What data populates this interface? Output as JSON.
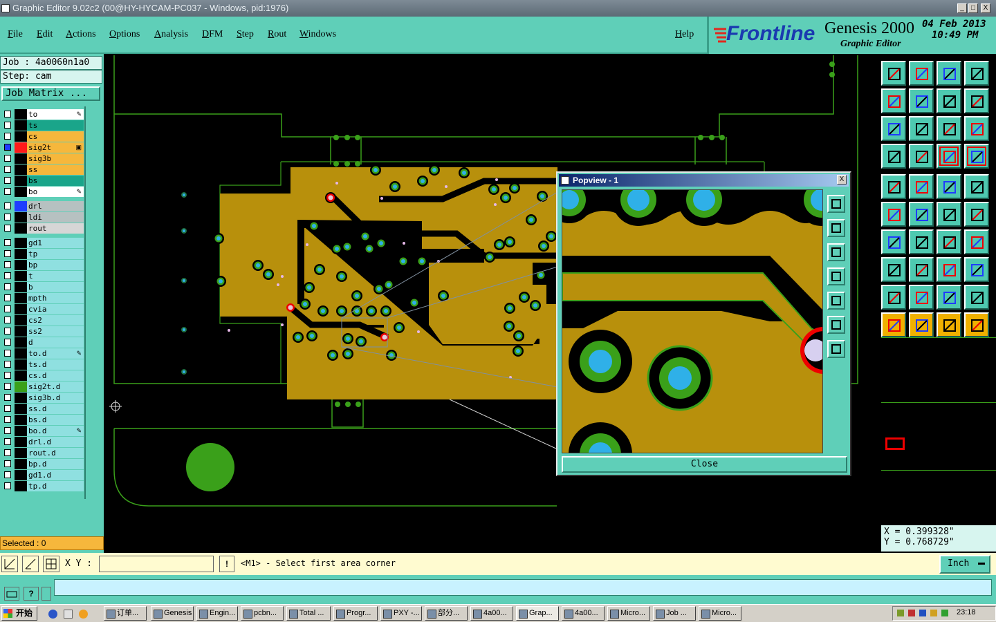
{
  "window": {
    "title": "Graphic Editor 9.02c2 (00@HY-HYCAM-PC037 - Windows, pid:1976)",
    "min": "_",
    "max": "□",
    "close": "X"
  },
  "menu": {
    "items": [
      "File",
      "Edit",
      "Actions",
      "Options",
      "Analysis",
      "DFM",
      "Step",
      "Rout",
      "Windows"
    ],
    "help": "Help"
  },
  "brand": {
    "logo": "Frontline",
    "product": "Genesis 2000",
    "subtitle": "Graphic Editor",
    "date": "04 Feb 2013",
    "time": "10:49 PM"
  },
  "job": {
    "job_label": "Job : 4a0060n1a0",
    "step_label": "Step: cam",
    "matrix_button": "Job Matrix ..."
  },
  "layers": [
    {
      "name": "to",
      "color": "#ffffff",
      "swatch": "#000000",
      "mark": "✎"
    },
    {
      "name": "ts",
      "color": "#1aa58a",
      "swatch": "#000000",
      "mark": ""
    },
    {
      "name": "cs",
      "color": "#f6b73c",
      "swatch": "#000000",
      "mark": ""
    },
    {
      "name": "sig2t",
      "color": "#f6b73c",
      "swatch": "#ff1a1a",
      "mark": "▣",
      "checked": true
    },
    {
      "name": "sig3b",
      "color": "#f6b73c",
      "swatch": "#000000",
      "mark": ""
    },
    {
      "name": "ss",
      "color": "#f6b73c",
      "swatch": "#000000",
      "mark": ""
    },
    {
      "name": "bs",
      "color": "#1aa58a",
      "swatch": "#000000",
      "mark": ""
    },
    {
      "name": "bo",
      "color": "#ffffff",
      "swatch": "#000000",
      "mark": "✎"
    },
    {
      "name": "drl",
      "color": "#b6c1c1",
      "swatch": "#1f3cff",
      "mark": "",
      "gap": true
    },
    {
      "name": "ldi",
      "color": "#b6c1c1",
      "swatch": "#000000",
      "mark": ""
    },
    {
      "name": "rout",
      "color": "#d6d6d6",
      "swatch": "#000000",
      "mark": ""
    },
    {
      "name": "gd1",
      "color": "#8fe0e0",
      "swatch": "#000000",
      "mark": "",
      "gap": true
    },
    {
      "name": "tp",
      "color": "#8fe0e0",
      "swatch": "#000000",
      "mark": ""
    },
    {
      "name": "bp",
      "color": "#8fe0e0",
      "swatch": "#000000",
      "mark": ""
    },
    {
      "name": "t",
      "color": "#8fe0e0",
      "swatch": "#000000",
      "mark": ""
    },
    {
      "name": "b",
      "color": "#8fe0e0",
      "swatch": "#000000",
      "mark": ""
    },
    {
      "name": "mpth",
      "color": "#8fe0e0",
      "swatch": "#000000",
      "mark": ""
    },
    {
      "name": "cvia",
      "color": "#8fe0e0",
      "swatch": "#000000",
      "mark": ""
    },
    {
      "name": "cs2",
      "color": "#8fe0e0",
      "swatch": "#000000",
      "mark": ""
    },
    {
      "name": "ss2",
      "color": "#8fe0e0",
      "swatch": "#000000",
      "mark": ""
    },
    {
      "name": "d",
      "color": "#8fe0e0",
      "swatch": "#000000",
      "mark": ""
    },
    {
      "name": "to.d",
      "color": "#8fe0e0",
      "swatch": "#000000",
      "mark": "✎"
    },
    {
      "name": "ts.d",
      "color": "#8fe0e0",
      "swatch": "#000000",
      "mark": ""
    },
    {
      "name": "cs.d",
      "color": "#8fe0e0",
      "swatch": "#000000",
      "mark": ""
    },
    {
      "name": "sig2t.d",
      "color": "#8fe0e0",
      "swatch": "#3aa01a",
      "mark": ""
    },
    {
      "name": "sig3b.d",
      "color": "#8fe0e0",
      "swatch": "#000000",
      "mark": ""
    },
    {
      "name": "ss.d",
      "color": "#8fe0e0",
      "swatch": "#000000",
      "mark": ""
    },
    {
      "name": "bs.d",
      "color": "#8fe0e0",
      "swatch": "#000000",
      "mark": ""
    },
    {
      "name": "bo.d",
      "color": "#8fe0e0",
      "swatch": "#000000",
      "mark": "✎"
    },
    {
      "name": "drl.d",
      "color": "#8fe0e0",
      "swatch": "#000000",
      "mark": ""
    },
    {
      "name": "rout.d",
      "color": "#8fe0e0",
      "swatch": "#000000",
      "mark": ""
    },
    {
      "name": "bp.d",
      "color": "#8fe0e0",
      "swatch": "#000000",
      "mark": ""
    },
    {
      "name": "gd1.d",
      "color": "#8fe0e0",
      "swatch": "#000000",
      "mark": ""
    },
    {
      "name": "tp.d",
      "color": "#8fe0e0",
      "swatch": "#000000",
      "mark": ""
    }
  ],
  "selected": "Selected : 0",
  "popview": {
    "title": "Popview - 1",
    "close_label": "Close",
    "close_x": "X"
  },
  "coords": {
    "x": "X = 0.399328\"",
    "y": "Y = 0.768729\""
  },
  "status": {
    "xy_label": "X Y :",
    "xy_value": "",
    "message": "<M1> - Select first area corner",
    "unit": "Inch",
    "bang": "!"
  },
  "taskbar": {
    "start": "开始",
    "tasks": [
      "订单...",
      "Genesis",
      "Engin...",
      "pcbn...",
      "Total ...",
      "Progr...",
      "PXY -...",
      "部分...",
      "4a00...",
      "Grap...",
      "4a00...",
      "Micro...",
      "Job ...",
      "Micro..."
    ],
    "clock": "23:18"
  },
  "colors": {
    "teal": "#5fcfb8",
    "copper": "#b8900c",
    "pad_green": "#3aa01a",
    "pad_cyan": "#2fb0e8",
    "outline": "#3aa01a"
  }
}
